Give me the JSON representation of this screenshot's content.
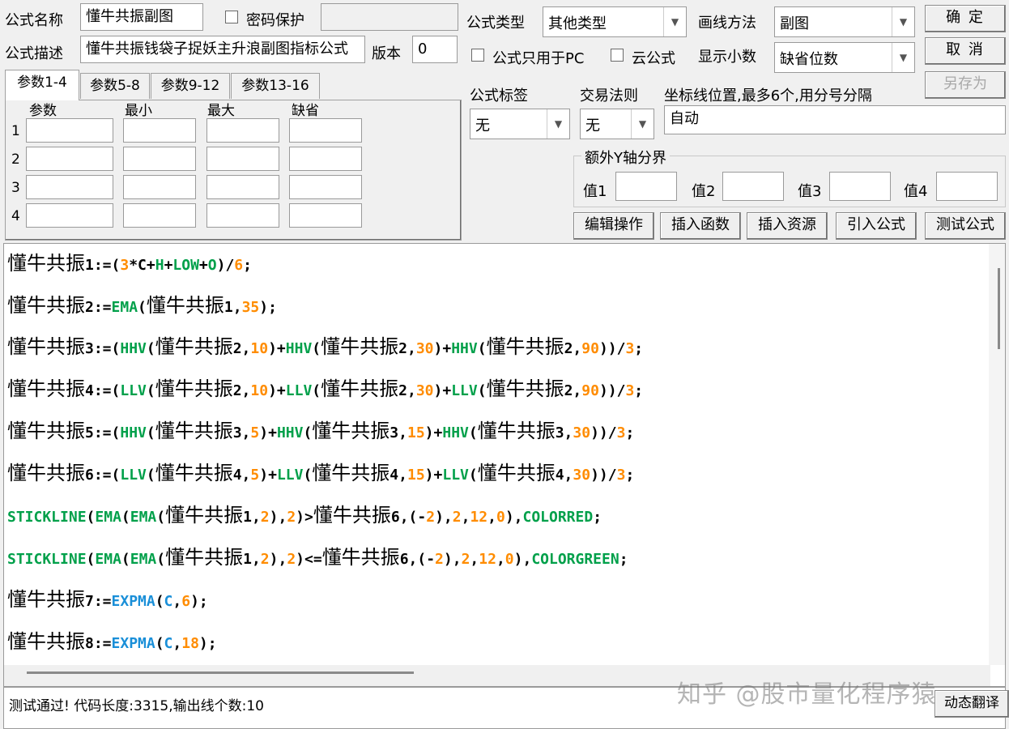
{
  "form": {
    "name_label": "公式名称",
    "name_value": "懂牛共振副图",
    "password_label": "密码保护",
    "desc_label": "公式描述",
    "desc_value": "懂牛共振钱袋子捉妖主升浪副图指标公式",
    "version_label": "版本",
    "version_value": "0",
    "type_label": "公式类型",
    "type_value": "其他类型",
    "draw_label": "画线方法",
    "draw_value": "副图",
    "pc_only_label": "公式只用于PC",
    "cloud_label": "云公式",
    "decimals_label": "显示小数",
    "decimals_value": "缺省位数",
    "tag_label": "公式标签",
    "tag_value": "无",
    "rule_label": "交易法则",
    "rule_value": "无",
    "coord_label": "坐标线位置,最多6个,用分号分隔",
    "coord_value": "自动",
    "yaxis_label": "额外Y轴分界",
    "yaxis_values": [
      "值1",
      "值2",
      "值3",
      "值4"
    ]
  },
  "buttons": {
    "ok": "确 定",
    "cancel": "取 消",
    "save_as": "另存为",
    "edit_ops": "编辑操作",
    "insert_func": "插入函数",
    "insert_res": "插入资源",
    "import_formula": "引入公式",
    "test_formula": "测试公式",
    "dynamic_translate": "动态翻译"
  },
  "tabs": [
    "参数1-4",
    "参数5-8",
    "参数9-12",
    "参数13-16"
  ],
  "param_headers": [
    "参数",
    "最小",
    "最大",
    "缺省"
  ],
  "param_rows": [
    "1",
    "2",
    "3",
    "4"
  ],
  "code_lines": [
    "懂牛共振1:=(3*C+H+LOW+O)/6;",
    "懂牛共振2:=EMA(懂牛共振1,35);",
    "懂牛共振3:=(HHV(懂牛共振2,10)+HHV(懂牛共振2,30)+HHV(懂牛共振2,90))/3;",
    "懂牛共振4:=(LLV(懂牛共振2,10)+LLV(懂牛共振2,30)+LLV(懂牛共振2,90))/3;",
    "懂牛共振5:=(HHV(懂牛共振3,5)+HHV(懂牛共振3,15)+HHV(懂牛共振3,30))/3;",
    "懂牛共振6:=(LLV(懂牛共振4,5)+LLV(懂牛共振4,15)+LLV(懂牛共振4,30))/3;",
    "STICKLINE(EMA(EMA(懂牛共振1,2),2)>懂牛共振6,(-2),2,12,0),COLORRED;",
    "STICKLINE(EMA(EMA(懂牛共振1,2),2)<=懂牛共振6,(-2),2,12,0),COLORGREEN;",
    "懂牛共振7:=EXPMA(C,6);",
    "懂牛共振8:=EXPMA(C,18);"
  ],
  "status_text": "测试通过! 代码长度:3315,输出线个数:10",
  "watermark": "知乎 @股市量化程序猿"
}
